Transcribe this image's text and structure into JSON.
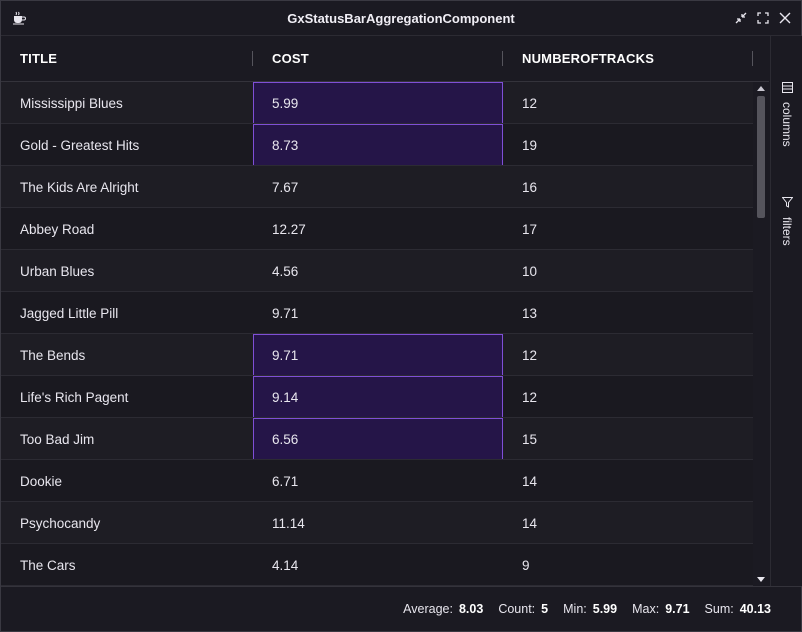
{
  "window": {
    "title": "GxStatusBarAggregationComponent"
  },
  "grid": {
    "columns": [
      {
        "label": "TITLE"
      },
      {
        "label": "COST"
      },
      {
        "label": "NUMBEROFTRACKS"
      }
    ],
    "rows": [
      {
        "title": "Mississippi Blues",
        "cost": "5.99",
        "tracks": "12",
        "selected": true
      },
      {
        "title": "Gold - Greatest Hits",
        "cost": "8.73",
        "tracks": "19",
        "selected": true
      },
      {
        "title": "The Kids Are Alright",
        "cost": "7.67",
        "tracks": "16",
        "selected": false
      },
      {
        "title": "Abbey Road",
        "cost": "12.27",
        "tracks": "17",
        "selected": false
      },
      {
        "title": "Urban Blues",
        "cost": "4.56",
        "tracks": "10",
        "selected": false
      },
      {
        "title": "Jagged Little Pill",
        "cost": "9.71",
        "tracks": "13",
        "selected": false
      },
      {
        "title": "The Bends",
        "cost": "9.71",
        "tracks": "12",
        "selected": true
      },
      {
        "title": "Life's Rich Pagent",
        "cost": "9.14",
        "tracks": "12",
        "selected": true
      },
      {
        "title": "Too Bad Jim",
        "cost": "6.56",
        "tracks": "15",
        "selected": true
      },
      {
        "title": "Dookie",
        "cost": "6.71",
        "tracks": "14",
        "selected": false
      },
      {
        "title": "Psychocandy",
        "cost": "11.14",
        "tracks": "14",
        "selected": false
      },
      {
        "title": "The Cars",
        "cost": "4.14",
        "tracks": "9",
        "selected": false
      }
    ]
  },
  "sidebar": {
    "columns_label": "columns",
    "filters_label": "filters"
  },
  "status": {
    "average_label": "Average:",
    "average_value": "8.03",
    "count_label": "Count:",
    "count_value": "5",
    "min_label": "Min:",
    "min_value": "5.99",
    "max_label": "Max:",
    "max_value": "9.71",
    "sum_label": "Sum:",
    "sum_value": "40.13"
  },
  "colors": {
    "background": "#1b1a22",
    "selection_fill": "#251548",
    "selection_border": "#7f4fd6"
  },
  "icons": [
    "app-icon",
    "collapse-icon",
    "maximize-icon",
    "close-icon",
    "columns-icon",
    "filter-icon",
    "scroll-up-icon",
    "scroll-down-icon"
  ]
}
